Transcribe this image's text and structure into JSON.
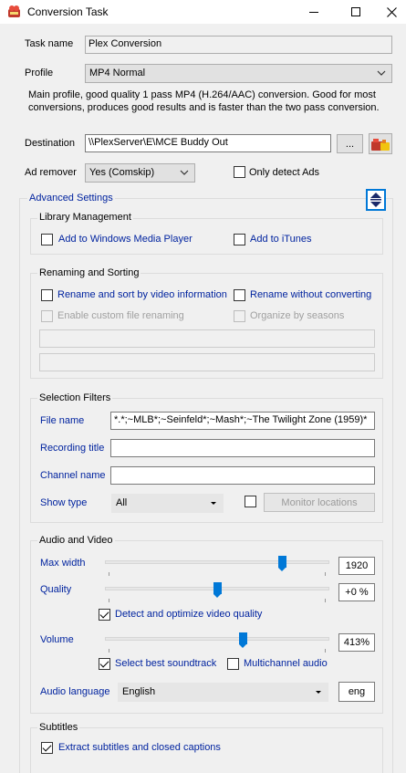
{
  "window": {
    "title": "Conversion Task",
    "minimize_glyph": "—",
    "close_glyph": "✕"
  },
  "task_name": {
    "label": "Task name",
    "value": "Plex Conversion"
  },
  "profile": {
    "label": "Profile",
    "selected": "MP4 Normal",
    "description": "Main profile, good quality 1 pass MP4 (H.264/AAC) conversion. Good for most conversions, produces good results and is faster than the two pass conversion."
  },
  "destination": {
    "label": "Destination",
    "value": "\\\\PlexServer\\E\\MCE Buddy Out",
    "browse_label": "..."
  },
  "ad_remover": {
    "label": "Ad remover",
    "selected": "Yes (Comskip)",
    "only_detect_label": "Only detect Ads"
  },
  "advanced": {
    "label": "Advanced Settings"
  },
  "library": {
    "title": "Library Management",
    "wmp_label": "Add to Windows Media Player",
    "itunes_label": "Add to iTunes"
  },
  "renaming": {
    "title": "Renaming and Sorting",
    "rename_sort_label": "Rename and sort by video information",
    "rename_without_label": "Rename without converting",
    "custom_rename_label": "Enable custom file renaming",
    "organize_label": "Organize by seasons"
  },
  "filters": {
    "title": "Selection Filters",
    "file_name_label": "File name",
    "file_name_value": "*.*;~MLB*;~Seinfeld*;~Mash*;~The Twilight Zone (1959)*",
    "recording_title_label": "Recording title",
    "recording_title_value": "",
    "channel_name_label": "Channel name",
    "channel_name_value": "",
    "show_type_label": "Show type",
    "show_type_selected": "All",
    "monitor_locations_label": "Monitor locations"
  },
  "audio_video": {
    "title": "Audio and Video",
    "max_width_label": "Max width",
    "max_width_value": "1920",
    "max_width_slider": 0.8,
    "quality_label": "Quality",
    "quality_value": "+0 %",
    "quality_slider": 0.5,
    "detect_optimize_label": "Detect and optimize video quality",
    "volume_label": "Volume",
    "volume_value": "413%",
    "volume_slider": 0.62,
    "best_soundtrack_label": "Select best soundtrack",
    "multichannel_label": "Multichannel audio",
    "audio_language_label": "Audio language",
    "audio_language_selected": "English",
    "audio_language_code": "eng"
  },
  "subtitles": {
    "title": "Subtitles",
    "extract_label": "Extract subtitles and closed captions"
  },
  "colors": {
    "link_blue": "#00239f",
    "accent": "#0078d7",
    "disabled": "#a0a0a0"
  }
}
